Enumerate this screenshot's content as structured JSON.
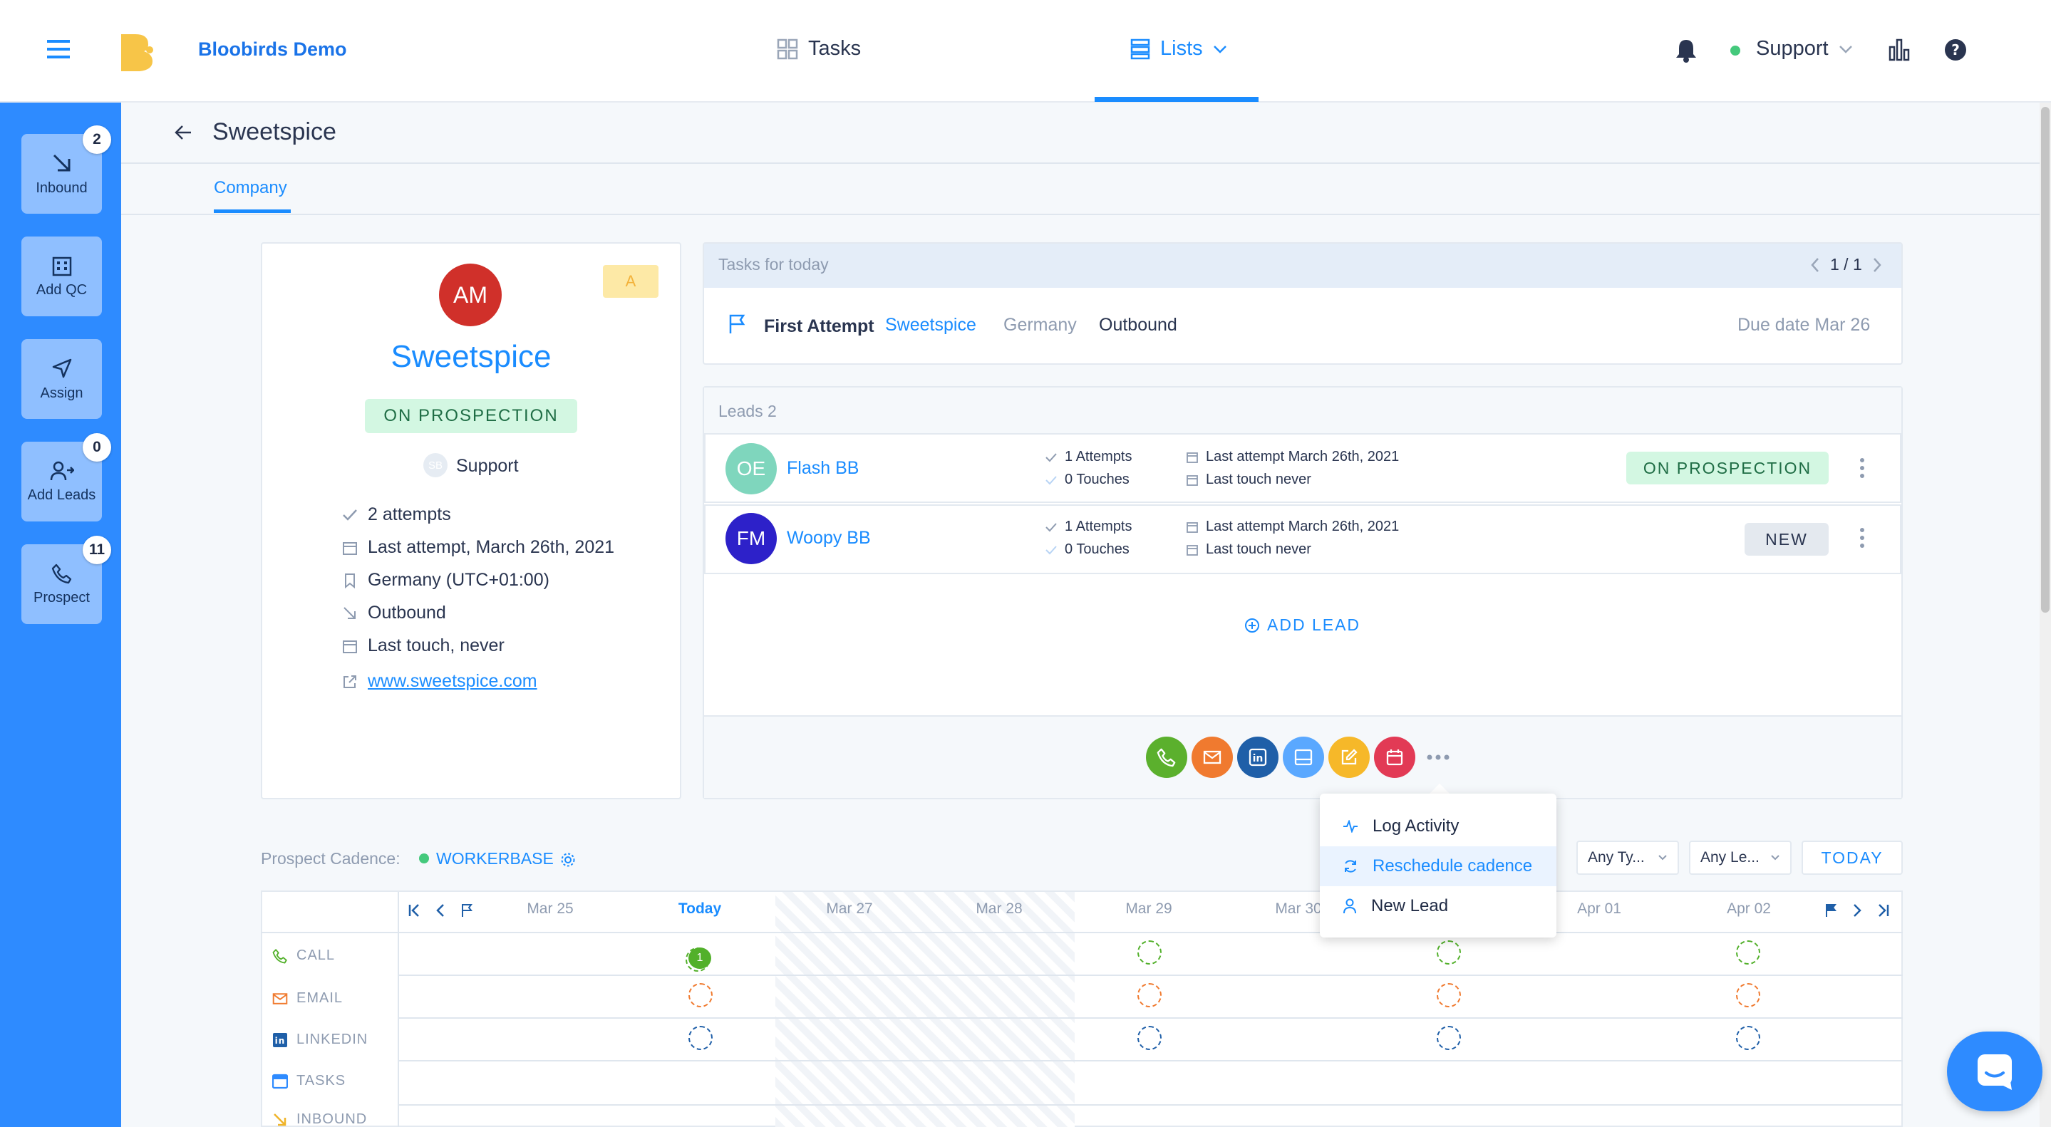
{
  "topbar": {
    "brand": "Bloobirds Demo",
    "tabs": [
      {
        "label": "Tasks"
      },
      {
        "label": "Lists"
      }
    ],
    "user_label": "Support"
  },
  "sidebar": {
    "items": [
      {
        "label": "Inbound",
        "badge": "2"
      },
      {
        "label": "Add QC"
      },
      {
        "label": "Assign"
      },
      {
        "label": "Add Leads",
        "badge": "0"
      },
      {
        "label": "Prospect",
        "badge": "11"
      }
    ]
  },
  "page": {
    "title": "Sweetspice",
    "tab": "Company"
  },
  "company": {
    "initials": "AM",
    "name": "Sweetspice",
    "score": "A",
    "status": "ON PROSPECTION",
    "owner_initials": "SB",
    "owner": "Support",
    "attempts": "2 attempts",
    "last_attempt": "Last attempt, March 26th, 2021",
    "country": "Germany (UTC+01:00)",
    "source": "Outbound",
    "last_touch": "Last touch, never",
    "website": "www.sweetspice.com"
  },
  "tasks": {
    "header": "Tasks for today",
    "pager": "1 / 1",
    "task": {
      "title": "First Attempt",
      "company": "Sweetspice",
      "country": "Germany",
      "source": "Outbound",
      "due": "Due date Mar 26"
    }
  },
  "leads": {
    "header": "Leads 2",
    "add_label": "ADD LEAD",
    "rows": [
      {
        "initials": "OE",
        "name": "Flash BB",
        "attempts": "1 Attempts",
        "touches": "0 Touches",
        "last_attempt": "Last attempt March 26th, 2021",
        "last_touch": "Last touch never",
        "status": "ON PROSPECTION",
        "color": "#7fd6bd"
      },
      {
        "initials": "FM",
        "name": "Woopy BB",
        "attempts": "1 Attempts",
        "touches": "0 Touches",
        "last_attempt": "Last attempt March 26th, 2021",
        "last_touch": "Last touch never",
        "status": "NEW",
        "color": "#2d21c9"
      }
    ]
  },
  "actions": {
    "menu": [
      {
        "label": "Log Activity"
      },
      {
        "label": "Reschedule cadence"
      },
      {
        "label": "New Lead"
      }
    ]
  },
  "cadence": {
    "label": "Prospect Cadence:",
    "name": "WORKERBASE",
    "filters": [
      "Any Ty...",
      "Any Le..."
    ],
    "today_button": "TODAY",
    "days": [
      "Mar 25",
      "Today",
      "Mar 27",
      "Mar 28",
      "Mar 29",
      "Mar 30",
      "Apr 01",
      "Apr 02"
    ],
    "channels": [
      {
        "label": "CALL",
        "color": "#52b02a"
      },
      {
        "label": "EMAIL",
        "color": "#f07a2f"
      },
      {
        "label": "LINKEDIN",
        "color": "#1f5fa8"
      },
      {
        "label": "TASKS",
        "color": "#2e8bff"
      },
      {
        "label": "INBOUND",
        "color": "#f0b429"
      }
    ],
    "today_call_count": "1"
  },
  "colors": {
    "accent": "#1a8cff",
    "sidebar": "#2e8bff",
    "company_avatar": "#d0302a"
  }
}
